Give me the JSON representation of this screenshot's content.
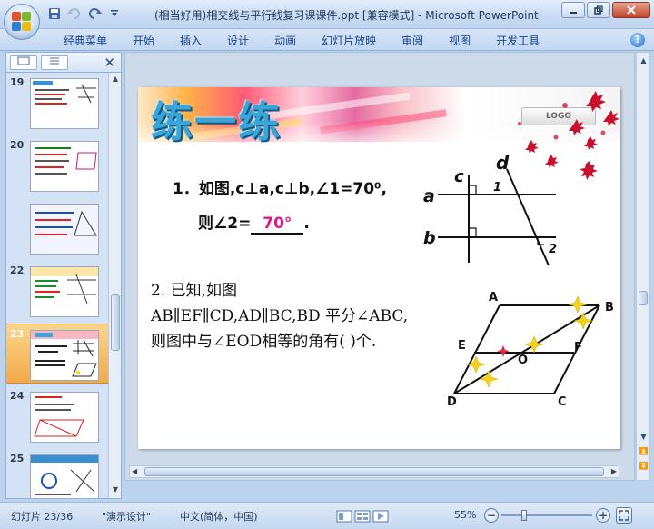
{
  "window": {
    "title": "(相当好用)相交线与平行线复习课课件.ppt [兼容模式] - Microsoft PowerPoint",
    "qat_icons": [
      "save-icon",
      "undo-icon",
      "redo-icon",
      "customize-dropdown-icon"
    ]
  },
  "ribbon": {
    "tabs": [
      "经典菜单",
      "开始",
      "插入",
      "设计",
      "动画",
      "幻灯片放映",
      "审阅",
      "视图",
      "开发工具"
    ],
    "help": "?"
  },
  "left_panel": {
    "slide_numbers": [
      "19",
      "20",
      "21",
      "22",
      "23",
      "24",
      "25"
    ],
    "selected": "23"
  },
  "slide": {
    "title": "练一练",
    "logo": "LOGO",
    "q1_line1": "1．如图,c⊥a,c⊥b,∠1=70⁰,",
    "q1_line2_prefix": "则∠2=",
    "q1_answer": "70°",
    "q1_line2_suffix": ".",
    "q2_line1": "2.  已知,如图",
    "q2_line2": "AB∥EF∥CD,AD∥BC,BD 平分∠ABC,",
    "q2_line3": "则图中与∠EOD相等的角有(      )个.",
    "fig1_labels": {
      "c": "c",
      "d": "d",
      "a": "a",
      "b": "b",
      "one": "1",
      "two": "2"
    },
    "fig2_labels": {
      "A": "A",
      "B": "B",
      "E": "E",
      "F": "F",
      "O": "O",
      "D": "D",
      "C": "C"
    }
  },
  "status": {
    "slide_info": "幻灯片 23/36",
    "theme": "\"演示设计\"",
    "language": "中文(简体，中国)",
    "zoom": "55%",
    "zoom_fraction": 0.55
  }
}
